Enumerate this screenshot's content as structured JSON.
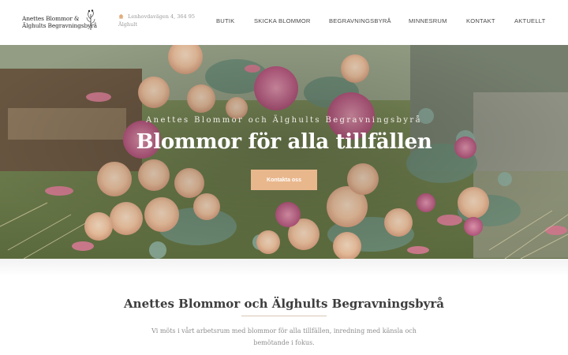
{
  "header": {
    "logo_line1": "Anettes Blommor &",
    "logo_line2": "Älghults Begravningsbyrå",
    "address_line1": "Lenhovdavägen 4, 364 95",
    "address_line2": "Älghult",
    "nav": [
      "BUTIK",
      "SKICKA BLOMMOR",
      "BEGRAVNINGSBYRÅ",
      "MINNESRUM",
      "KONTAKT",
      "AKTUELLT"
    ]
  },
  "hero": {
    "subtitle": "Anettes Blommor och Älghults Begravningsbyrå",
    "title": "Blommor för alla tillfällen",
    "button": "Kontakta oss"
  },
  "intro": {
    "title": "Anettes Blommor och Älghults Begravningsbyrå",
    "text": "Vi möts i vårt arbetsrum med blommor för alla tillfällen, inredning med känsla och bemötande i fokus."
  },
  "colors": {
    "accent": "#e9b78c",
    "nav_text": "#4a4a4a"
  }
}
